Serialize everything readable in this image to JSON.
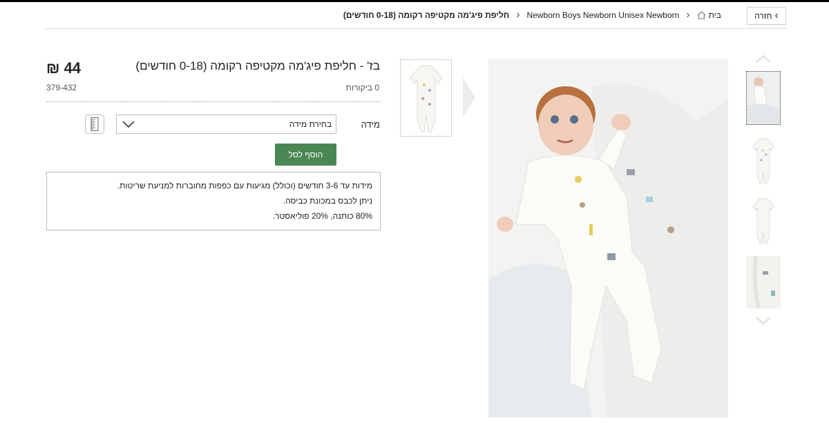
{
  "header": {
    "back_label": "חזרה",
    "breadcrumb": {
      "home": "בית",
      "category": "Newborn Boys Newborn Unisex Newborn",
      "current": "חליפת פיג'מה מקטיפה רקומה (0-18 חודשים)"
    }
  },
  "product": {
    "title": "בז' - חליפת פיג'מה מקטיפה רקומה (0-18 חודשים)",
    "price": "44 ₪",
    "reviews": "0 ביקורות",
    "sku": "379-432",
    "size_label": "מידה",
    "size_placeholder": "בחירת מידה",
    "add_to_cart": "הוסף לסל",
    "description": [
      "מידות עד 3-6 חודשים (וכולל) מגיעות עם כפפות מחוברות למניעת שריטות.",
      "ניתן לכבס במכונת כביסה.",
      "80% כותנה, 20% פוליאסטר."
    ]
  },
  "icons": {
    "back": "chevron-left-icon",
    "home": "home-icon",
    "breadcrumb_sep": "chevron-right-icon",
    "size_dropdown": "chevron-down-icon",
    "size_guide": "ruler-icon",
    "thumb_up": "chevron-up-icon",
    "thumb_down": "chevron-down-icon"
  },
  "colors": {
    "accent_green": "#4a8754",
    "top_bar": "#000000"
  }
}
